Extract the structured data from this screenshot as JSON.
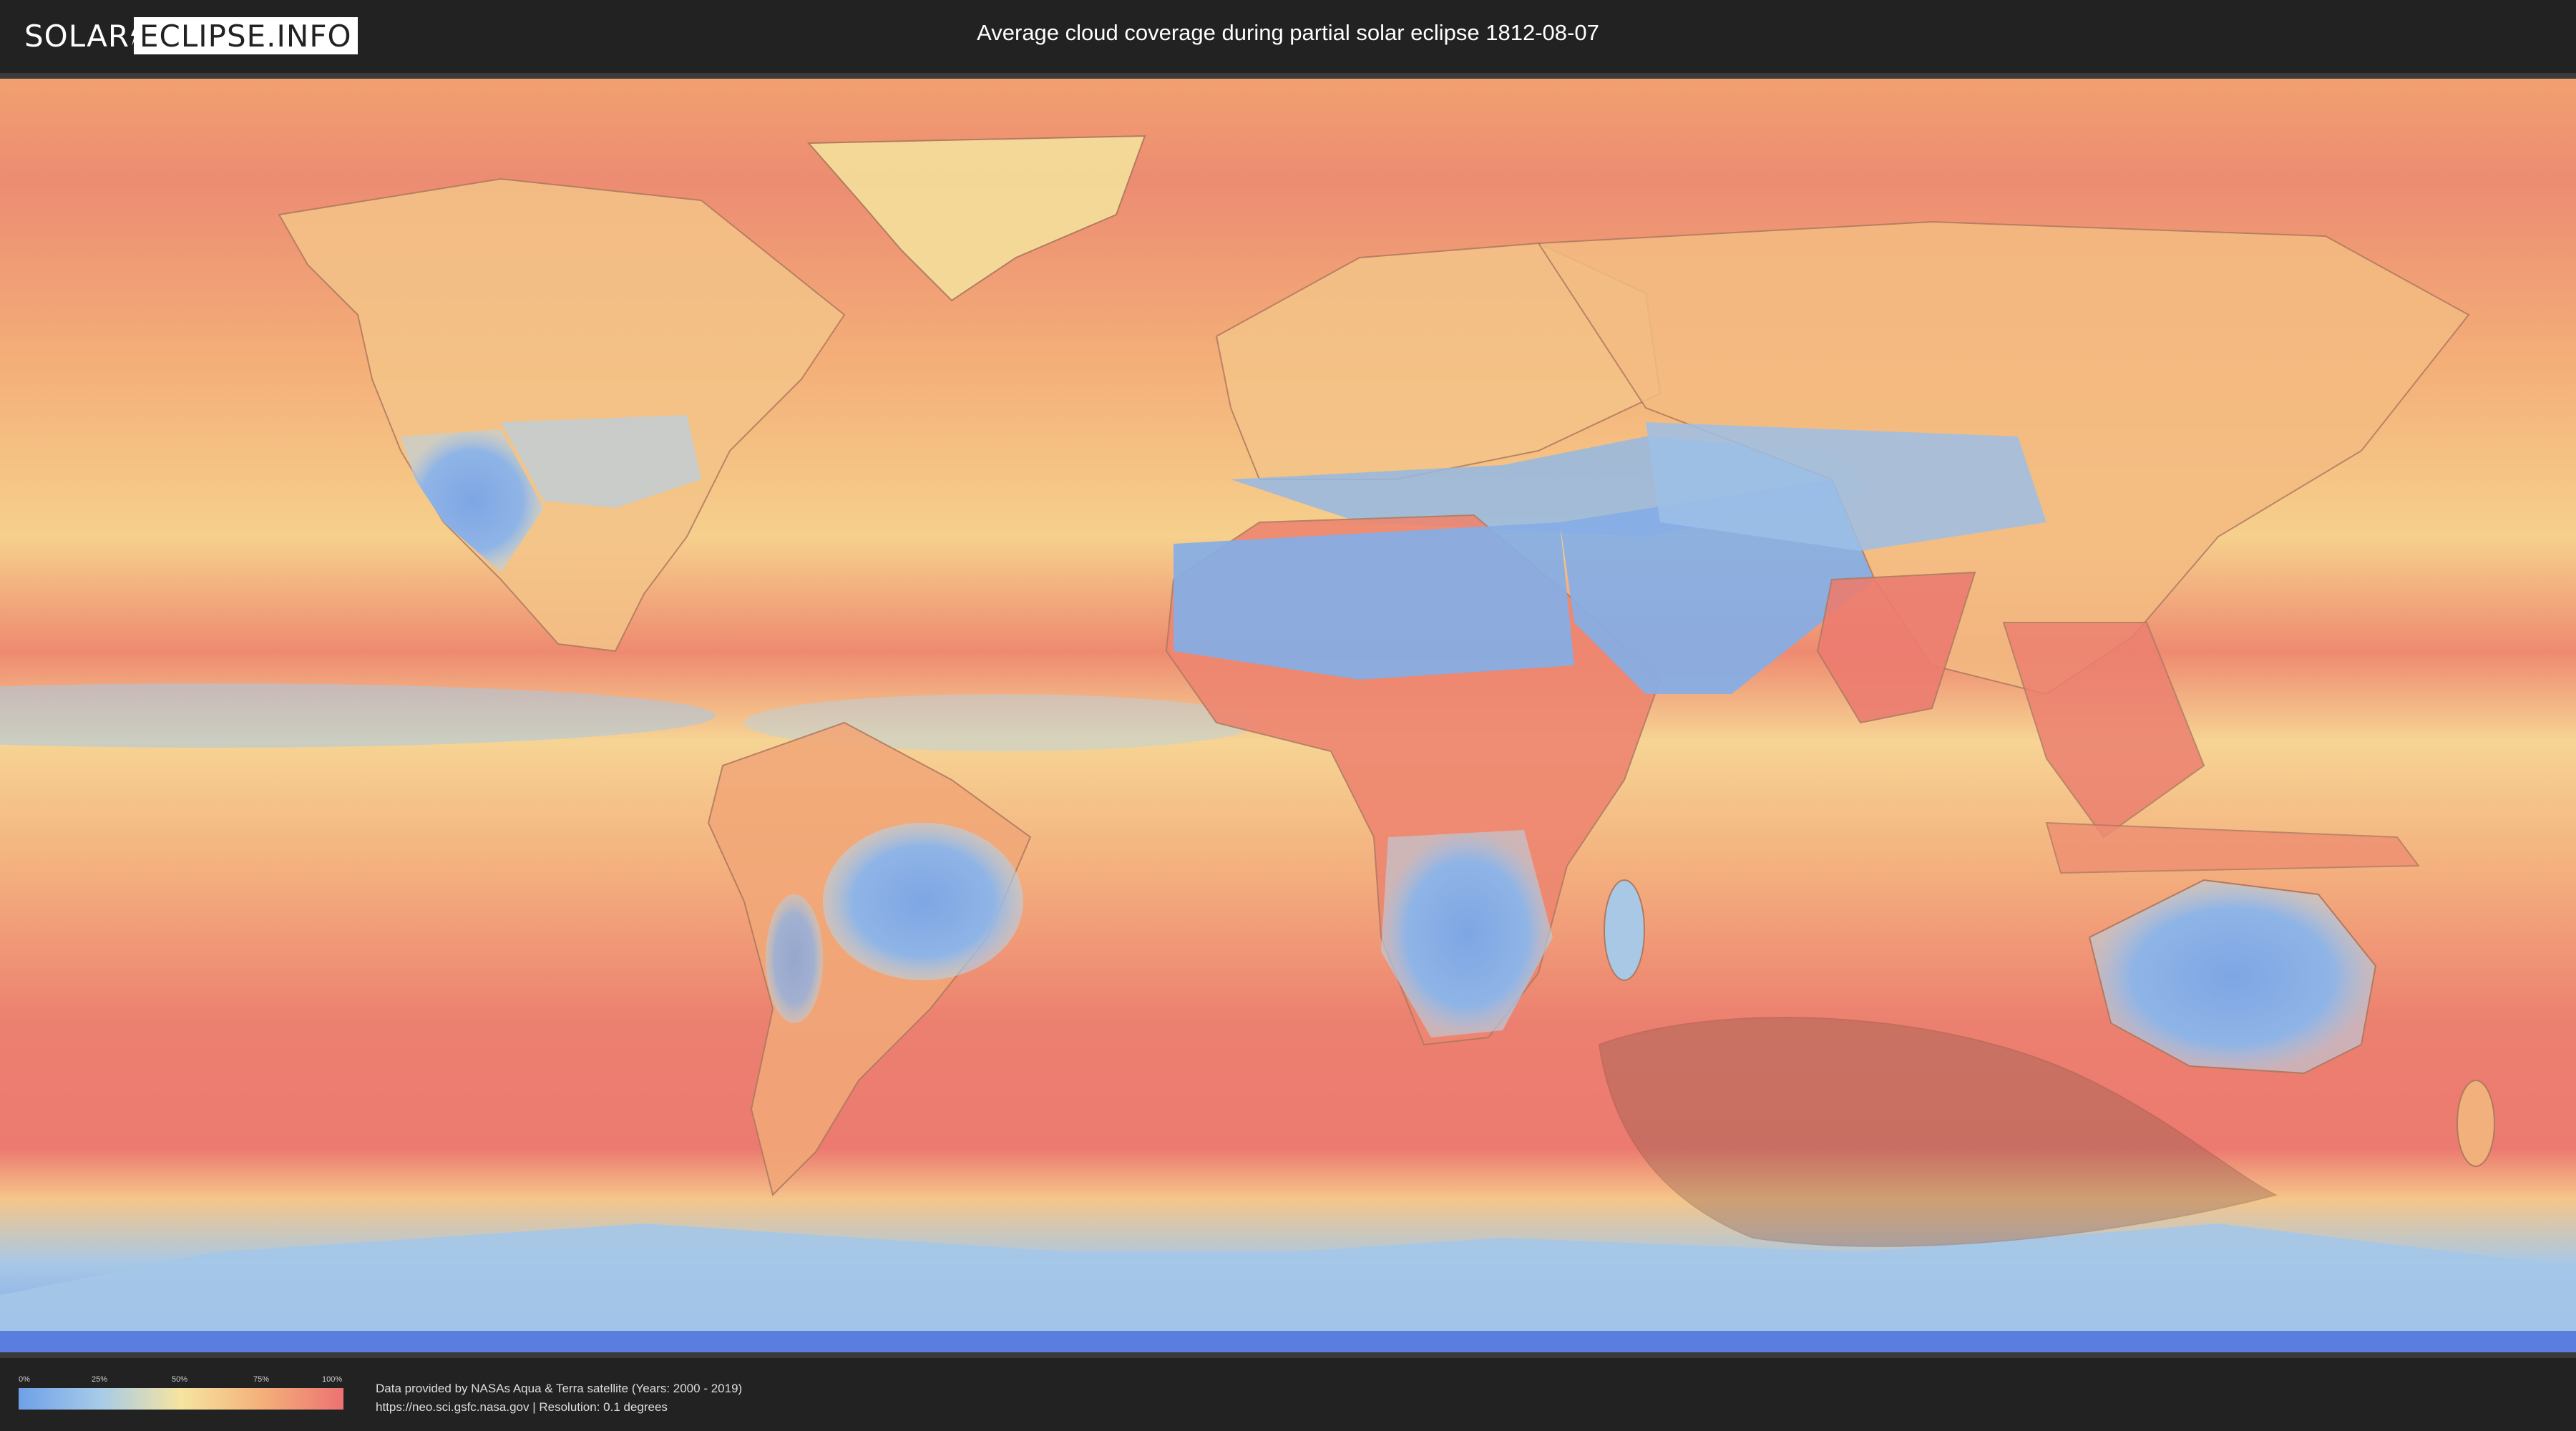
{
  "header": {
    "logo_left": "SOLAR",
    "logo_right": "ECLIPSE.INFO",
    "title": "Average cloud coverage during partial solar eclipse 1812-08-07"
  },
  "map": {
    "type": "cloud-coverage-world-map",
    "eclipse_shadow": "partial eclipse visibility zone over Southern Ocean / Antarctica south of Africa and Australia",
    "colors": {
      "clear": "#6fa0e8",
      "low": "#a6cbe8",
      "mid": "#f6e4a0",
      "high": "#f4b07a",
      "overcast": "#ec7272",
      "shadow": "#8a5a4a"
    }
  },
  "legend": {
    "ticks": [
      "0%",
      "25%",
      "50%",
      "75%",
      "100%"
    ]
  },
  "footer": {
    "credit_line_1": "Data provided by NASAs Aqua & Terra satellite (Years: 2000 - 2019)",
    "credit_line_2": "https://neo.sci.gsfc.nasa.gov | Resolution: 0.1 degrees"
  }
}
